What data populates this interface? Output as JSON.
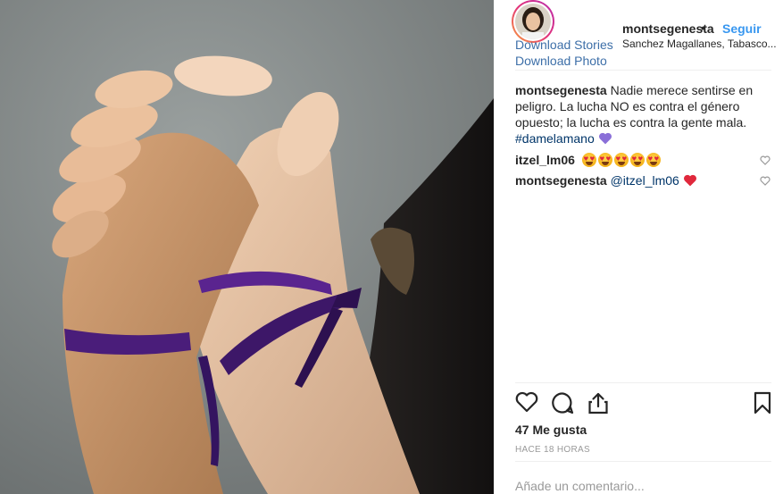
{
  "header": {
    "username": "montsegenesta",
    "separator": "•",
    "follow_label": "Seguir",
    "location": "Sanchez Magallanes, Tabasco...",
    "download_stories": "Download Stories",
    "download_photo": "Download Photo"
  },
  "caption": {
    "username": "montsegenesta",
    "text": "Nadie merece sentirse en peligro. La lucha NO es contra el género opuesto; la lucha es contra la gente mala.",
    "hashtag": "#damelamano",
    "heart_color": "#8a6fd8"
  },
  "comments": [
    {
      "username": "itzel_lm06",
      "emoji_count": 5,
      "emoji_name": "heart-eyes-emoji"
    },
    {
      "username": "montsegenesta",
      "mention": "@itzel_lm06",
      "heart_color": "#e0283c"
    }
  ],
  "actions": {
    "icons": [
      "like-icon",
      "comment-icon",
      "share-icon",
      "save-icon"
    ]
  },
  "likes_label": "47 Me gusta",
  "timestamp": "HACE 18 HORAS",
  "comment_input": {
    "placeholder": "Añade un comentario..."
  },
  "colors": {
    "link": "#3897f0",
    "download": "#3d6fa8",
    "ribbon": "#4a1d7a"
  }
}
